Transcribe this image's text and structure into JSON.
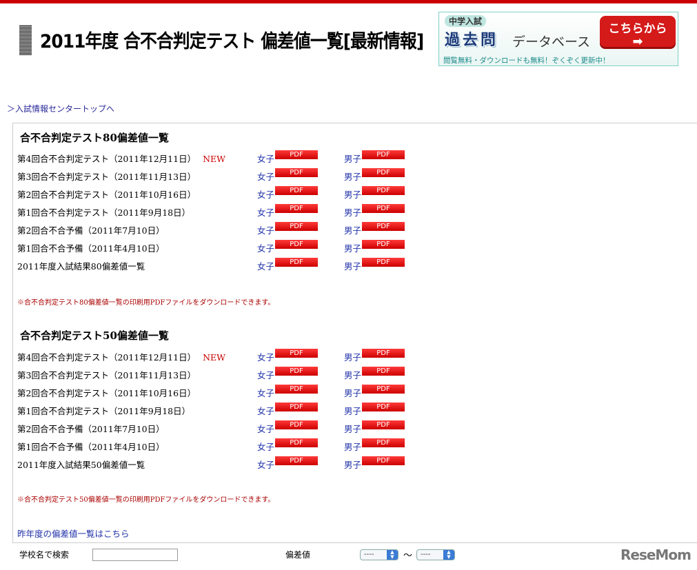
{
  "header": {
    "title": "2011年度 合不合判定テスト 偏差値一覧[最新情報]"
  },
  "banner": {
    "badge": "中学入試",
    "kakomon": "過去問",
    "database": "データベース",
    "button_label": "こちらから",
    "button_arrow": "➡",
    "subtext": "閲覧無料・ダウンロードも無料！ぞくぞく更新中！"
  },
  "nav": {
    "top_link": "＞入試情報センタートップへ"
  },
  "labels": {
    "girls": "女子",
    "boys": "男子",
    "pdf": "PDF",
    "new": "NEW"
  },
  "section80": {
    "title": "合不合判定テスト80偏差値一覧",
    "rows": [
      {
        "label": "第4回合不合判定テスト（2011年12月11日）",
        "new": "NEW"
      },
      {
        "label": "第3回合不合判定テスト（2011年11月13日）",
        "new": ""
      },
      {
        "label": "第2回合不合判定テスト（2011年10月16日）",
        "new": ""
      },
      {
        "label": "第1回合不合判定テスト（2011年9月18日）",
        "new": ""
      },
      {
        "label": "第2回合不合予備（2011年7月10日）",
        "new": ""
      },
      {
        "label": "第1回合不合予備（2011年4月10日）",
        "new": ""
      },
      {
        "label": "2011年度入試結果80偏差値一覧",
        "new": ""
      }
    ],
    "note": "※合不合判定テスト80偏差値一覧の印刷用PDFファイルをダウンロードできます。"
  },
  "section50": {
    "title": "合不合判定テスト50偏差値一覧",
    "rows": [
      {
        "label": "第4回合不合判定テスト（2011年12月11日）",
        "new": "NEW"
      },
      {
        "label": "第3回合不合判定テスト（2011年11月13日）",
        "new": ""
      },
      {
        "label": "第2回合不合判定テスト（2011年10月16日）",
        "new": ""
      },
      {
        "label": "第1回合不合判定テスト（2011年9月18日）",
        "new": ""
      },
      {
        "label": "第2回合不合予備（2011年7月10日）",
        "new": ""
      },
      {
        "label": "第1回合不合予備（2011年4月10日）",
        "new": ""
      },
      {
        "label": "2011年度入試結果50偏差値一覧",
        "new": ""
      }
    ],
    "note": "※合不合判定テスト50偏差値一覧の印刷用PDFファイルをダウンロードできます。"
  },
  "prev_year_link": "昨年度の偏差値一覧はこちら",
  "search": {
    "school_label": "学校名で検索",
    "school_value": "",
    "deviation_label": "偏差値",
    "from_value": "----",
    "to_value": "----",
    "tilde": "〜"
  },
  "footer": {
    "logo": "ReseMom"
  }
}
